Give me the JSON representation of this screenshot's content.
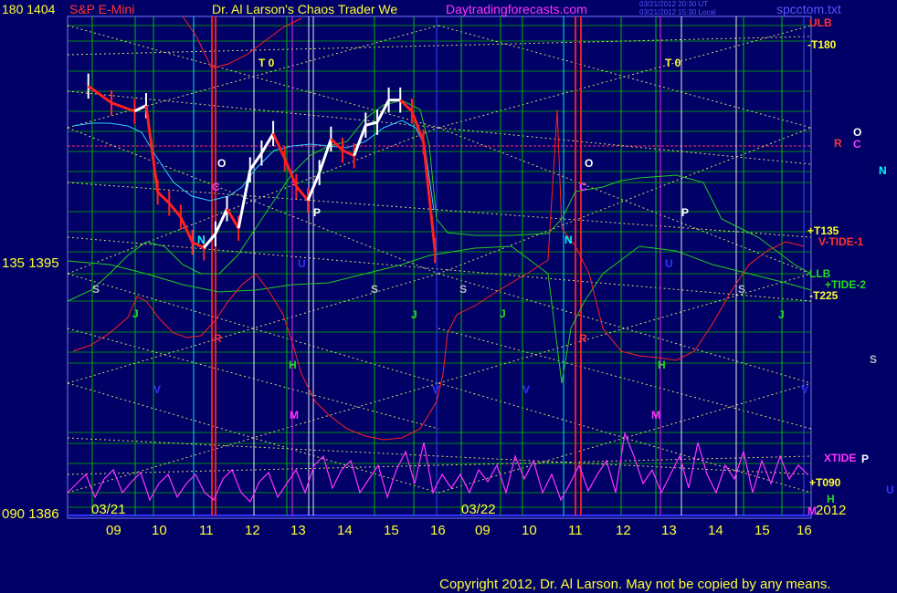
{
  "header": {
    "instrument": "180  1404",
    "symbol": "S&P E-Mini",
    "title": "Dr. Al Larson's Chaos Trader We",
    "site": "Daytradingforecasts.com",
    "stamp1": "03/21/2012 20:30 UT",
    "stamp2": "03/21/2012 15:30 Local",
    "file": "spcctom.txt"
  },
  "y_axis": {
    "top_label": "180  1404",
    "mid_label": "135  1395",
    "bottom_label": "090  1386"
  },
  "x_axis": {
    "dates": [
      "03/21",
      "03/22"
    ],
    "hours": [
      "09",
      "10",
      "11",
      "12",
      "13",
      "14",
      "15",
      "16",
      "09",
      "10",
      "11",
      "12",
      "13",
      "14",
      "15",
      "16"
    ]
  },
  "right_labels": {
    "ulb": "ULB",
    "t180": "-T180",
    "o": "O",
    "r": "R",
    "c": "C",
    "n": "N",
    "t135": "+T135",
    "vtide1": "V-TIDE-1",
    "llb": "LLB",
    "tide2": "+TIDE-2",
    "t225": "-T225",
    "s": "S",
    "xtide": "XTIDE",
    "p": "P",
    "t090": "+T090",
    "h": "H",
    "u": "U",
    "m": "M",
    "year": "2012"
  },
  "markers": {
    "t0": "T 0",
    "o": "O",
    "c": "C",
    "n": "N",
    "r": "R",
    "p": "P",
    "u": "U",
    "s": "S",
    "j": "J",
    "h": "H",
    "v": "V",
    "m": "M"
  },
  "footer": {
    "copyright": "Copyright 2012, Dr. Al Larson. May not be copied by any means."
  },
  "colors": {
    "background": "#000066",
    "grid_green": "#00aa00",
    "yellow": "#ffff33",
    "red": "#ff2020",
    "cyan": "#00ffff",
    "magenta": "#ff33ff",
    "white": "#ffffff"
  },
  "chart_data": {
    "type": "line",
    "title": "S&P E-Mini",
    "ylim": [
      1386,
      1404
    ],
    "y_ticks": [
      1386,
      1395,
      1404
    ],
    "x_sessions": [
      "03/21",
      "03/22"
    ],
    "x_ticks": [
      "09",
      "10",
      "11",
      "12",
      "13",
      "14",
      "15",
      "16",
      "09",
      "10",
      "11",
      "12",
      "13",
      "14",
      "15",
      "16"
    ],
    "series": [
      {
        "name": "",
        "color": "#ffffff",
        "x": [
          8.5,
          9,
          9.5,
          9.75,
          10,
          10.25,
          10.5,
          10.75,
          11,
          11.25,
          11.5,
          11.75,
          12,
          12.25,
          12.5,
          12.75,
          13,
          13.25,
          13.5,
          13.75,
          14,
          14.25,
          14.5,
          14.75,
          15,
          15.25,
          15.5,
          15.75,
          16
        ],
        "values": [
          1401.5,
          1400.9,
          1400.6,
          1400.8,
          1397.7,
          1397.3,
          1396.8,
          1395.9,
          1395.7,
          1396.2,
          1397.1,
          1396.4,
          1398.5,
          1399.1,
          1399.8,
          1398.9,
          1397.9,
          1397.4,
          1398.4,
          1399.6,
          1399.2,
          1399.0,
          1400.1,
          1400.2,
          1401.0,
          1401.0,
          1400.6,
          1399.5,
          1395.6
        ]
      }
    ]
  }
}
